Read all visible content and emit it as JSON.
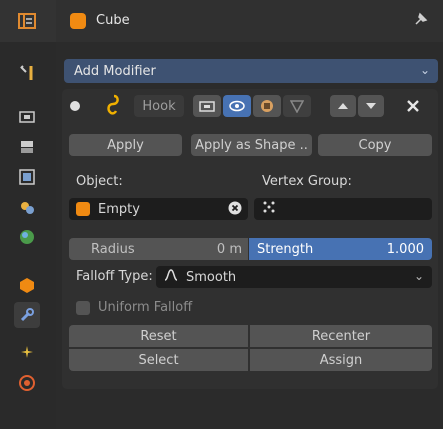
{
  "header": {
    "object_name": "Cube",
    "pin_icon": "pin-icon"
  },
  "sidebar": {
    "items": [
      "tool-icon",
      "wrench-settings-icon",
      "render-icon",
      "output-icon",
      "view-layer-icon",
      "scene-icon",
      "world-icon",
      "object-icon",
      "modifier-icon",
      "particles-icon",
      "physics-icon"
    ]
  },
  "add_modifier": {
    "label": "Add Modifier"
  },
  "modifier": {
    "name": "Hook",
    "apply_label": "Apply",
    "apply_shape_label": "Apply as Shape ..",
    "copy_label": "Copy",
    "object_label": "Object:",
    "object_value": "Empty",
    "vertex_group_label": "Vertex Group:",
    "radius_label": "Radius",
    "radius_value": "0 m",
    "strength_label": "Strength",
    "strength_value": "1.000",
    "falloff_label": "Falloff Type:",
    "falloff_value": "Smooth",
    "uniform_falloff_label": "Uniform Falloff",
    "reset_label": "Reset",
    "recenter_label": "Recenter",
    "select_label": "Select",
    "assign_label": "Assign"
  },
  "colors": {
    "accent": "#4772b3",
    "object_orange": "#f08a12",
    "hook_yellow": "#f0b000"
  }
}
